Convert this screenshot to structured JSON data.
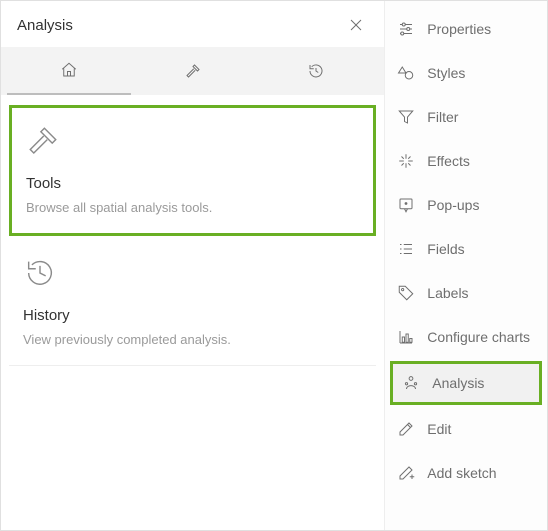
{
  "panel": {
    "title": "Analysis"
  },
  "cards": {
    "tools": {
      "title": "Tools",
      "desc": "Browse all spatial analysis tools."
    },
    "history": {
      "title": "History",
      "desc": "View previously completed analysis."
    }
  },
  "rail": {
    "properties": "Properties",
    "styles": "Styles",
    "filter": "Filter",
    "effects": "Effects",
    "popups": "Pop-ups",
    "fields": "Fields",
    "labels": "Labels",
    "configure_charts": "Configure charts",
    "analysis": "Analysis",
    "edit": "Edit",
    "add_sketch": "Add sketch"
  }
}
